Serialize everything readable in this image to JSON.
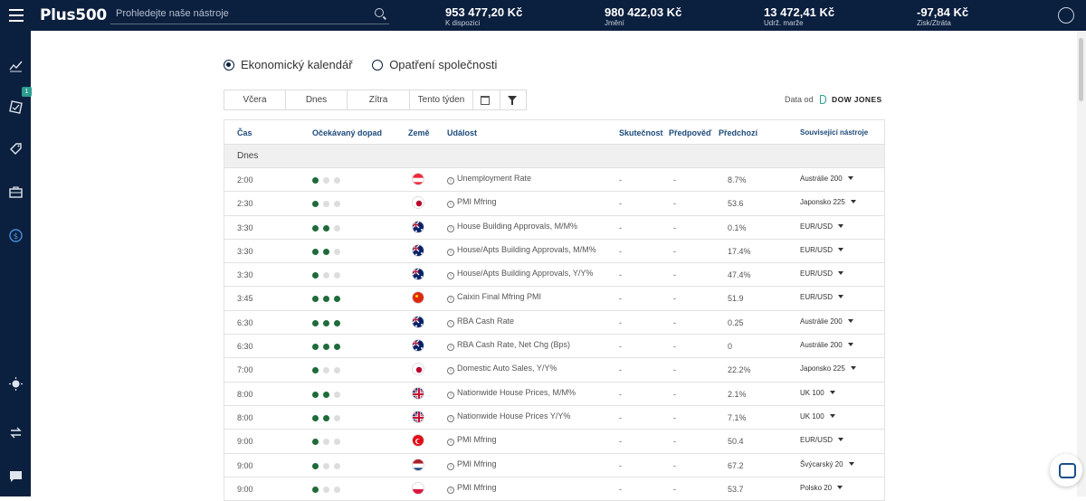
{
  "header": {
    "logo": "Plus500",
    "search_placeholder": "Prohledejte naše nástroje",
    "metrics": [
      {
        "value": "953 477,20 Kč",
        "label": "K dispozici"
      },
      {
        "value": "980 422,03 Kč",
        "label": "Jmění"
      },
      {
        "value": "13 472,41 Kč",
        "label": "Udrž. marže"
      },
      {
        "value": "-97,84 Kč",
        "label": "Zisk/Ztráta"
      }
    ]
  },
  "sidebar": {
    "icons": [
      "chart-icon",
      "positions-icon",
      "tag-icon",
      "briefcase-icon",
      "dollar-icon",
      "brightness-icon",
      "transfer-icon",
      "chat-icon"
    ],
    "badge": "1"
  },
  "tabs": [
    {
      "label": "Ekonomický kalendář",
      "selected": true
    },
    {
      "label": "Opatření společnosti",
      "selected": false
    }
  ],
  "filters": [
    "Včera",
    "Dnes",
    "Zítra",
    "Tento týden"
  ],
  "source": {
    "label": "Data od",
    "brand": "DOW JONES"
  },
  "table": {
    "headers": {
      "time": "Čas",
      "impact": "Očekávaný dopad",
      "country": "Země",
      "event": "Událost",
      "actual": "Skutečnost",
      "forecast": "Předpověď",
      "previous": "Předchozí",
      "instruments": "Související nástroje"
    },
    "group": "Dnes",
    "rows": [
      {
        "time": "2:00",
        "impact": 1,
        "flag": "austria",
        "event": "Unemployment Rate",
        "actual": "-",
        "forecast": "-",
        "previous": "8.7%",
        "instrument": "Austrálie 200"
      },
      {
        "time": "2:30",
        "impact": 1,
        "flag": "japan",
        "event": "PMI Mfring",
        "actual": "-",
        "forecast": "-",
        "previous": "53.6",
        "instrument": "Japonsko 225"
      },
      {
        "time": "3:30",
        "impact": 2,
        "flag": "australia",
        "event": "House Building Approvals, M/M%",
        "actual": "-",
        "forecast": "-",
        "previous": "0.1%",
        "instrument": "EUR/USD"
      },
      {
        "time": "3:30",
        "impact": 2,
        "flag": "australia",
        "event": "House/Apts Building Approvals, M/M%",
        "actual": "-",
        "forecast": "-",
        "previous": "17.4%",
        "instrument": "EUR/USD"
      },
      {
        "time": "3:30",
        "impact": 1,
        "flag": "australia",
        "event": "House/Apts Building Approvals, Y/Y%",
        "actual": "-",
        "forecast": "-",
        "previous": "47.4%",
        "instrument": "EUR/USD"
      },
      {
        "time": "3:45",
        "impact": 3,
        "flag": "china",
        "event": "Caixin Final Mfring PMI",
        "actual": "-",
        "forecast": "-",
        "previous": "51.9",
        "instrument": "EUR/USD"
      },
      {
        "time": "6:30",
        "impact": 3,
        "flag": "australia",
        "event": "RBA Cash Rate",
        "actual": "-",
        "forecast": "-",
        "previous": "0.25",
        "instrument": "Austrálie 200"
      },
      {
        "time": "6:30",
        "impact": 3,
        "flag": "australia",
        "event": "RBA Cash Rate, Net Chg (Bps)",
        "actual": "-",
        "forecast": "-",
        "previous": "0",
        "instrument": "Austrálie 200"
      },
      {
        "time": "7:00",
        "impact": 1,
        "flag": "japan",
        "event": "Domestic Auto Sales, Y/Y%",
        "actual": "-",
        "forecast": "-",
        "previous": "22.2%",
        "instrument": "Japonsko 225"
      },
      {
        "time": "8:00",
        "impact": 2,
        "flag": "uk",
        "event": "Nationwide House Prices, M/M%",
        "actual": "-",
        "forecast": "-",
        "previous": "2.1%",
        "instrument": "UK 100"
      },
      {
        "time": "8:00",
        "impact": 2,
        "flag": "uk",
        "event": "Nationwide House Prices Y/Y%",
        "actual": "-",
        "forecast": "-",
        "previous": "7.1%",
        "instrument": "UK 100"
      },
      {
        "time": "9:00",
        "impact": 1,
        "flag": "turkey",
        "event": "PMI Mfring",
        "actual": "-",
        "forecast": "-",
        "previous": "50.4",
        "instrument": "EUR/USD"
      },
      {
        "time": "9:00",
        "impact": 1,
        "flag": "netherlands",
        "event": "PMI Mfring",
        "actual": "-",
        "forecast": "-",
        "previous": "67.2",
        "instrument": "Švýcarský 20"
      },
      {
        "time": "9:00",
        "impact": 1,
        "flag": "poland",
        "event": "PMI Mfring",
        "actual": "-",
        "forecast": "-",
        "previous": "53.7",
        "instrument": "Polsko 20"
      }
    ]
  }
}
